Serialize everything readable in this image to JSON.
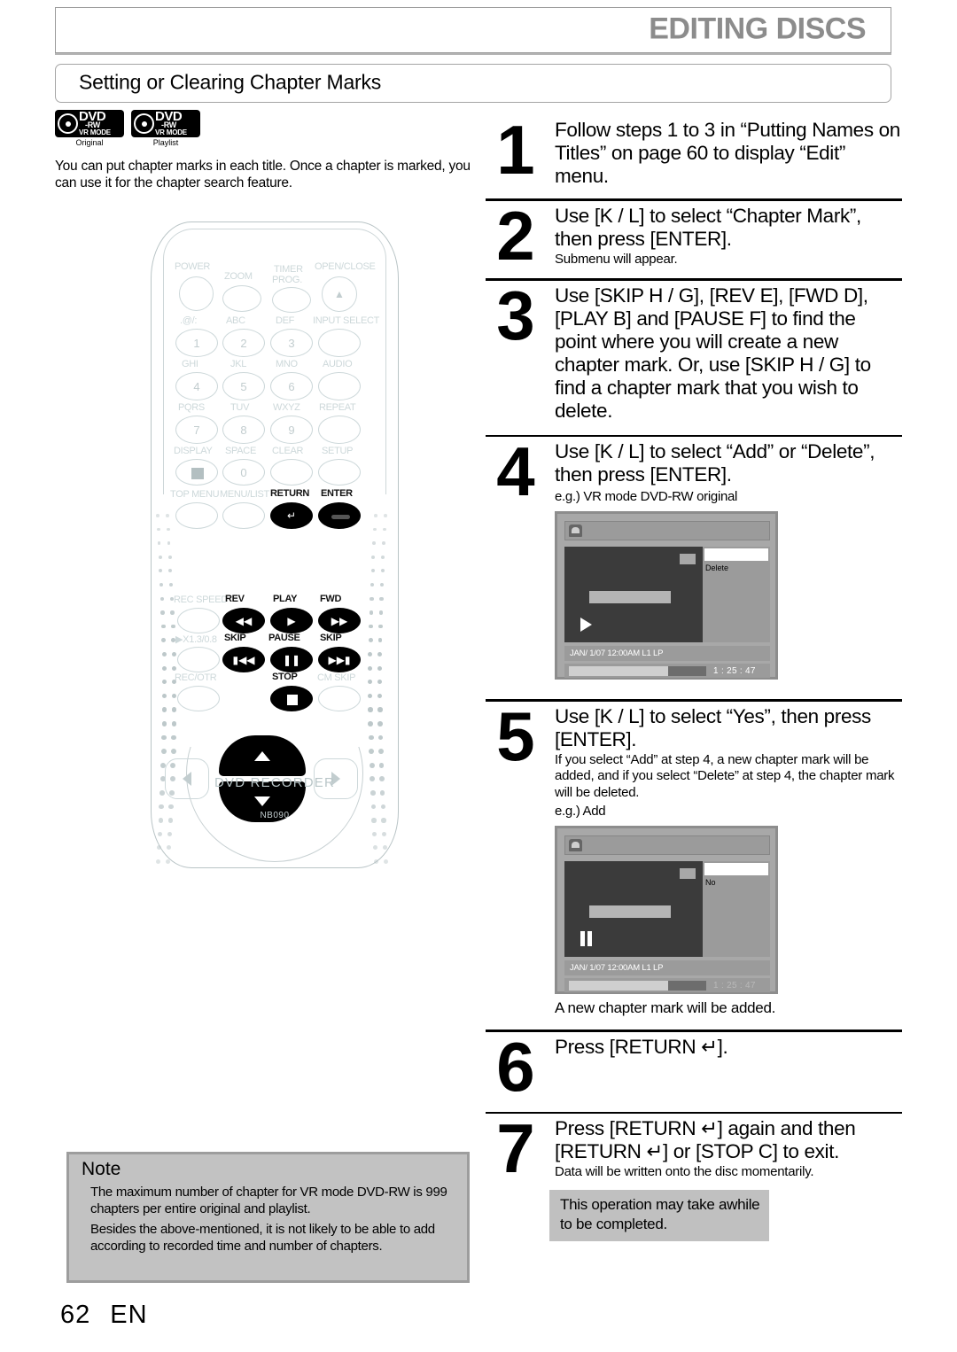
{
  "header": {
    "title": "EDITING DISCS",
    "section_title": "Setting or Clearing Chapter Marks"
  },
  "left": {
    "badges": [
      {
        "dvd": "DVD",
        "rw": "-RW",
        "mode": "VR MODE",
        "caption": "Original"
      },
      {
        "dvd": "DVD",
        "rw": "-RW",
        "mode": "VR MODE",
        "caption": "Playlist"
      }
    ],
    "intro": "You can put chapter marks in each title. Once a chapter is marked, you can use it for the chapter search feature."
  },
  "remote": {
    "brand": "DVD RECORDER",
    "model": "NB090",
    "labels": {
      "power": "POWER",
      "zoom": "ZOOM",
      "timer_prog_1": "TIMER",
      "timer_prog_2": "PROG.",
      "open_close": "OPEN/CLOSE",
      "key1_letters": ".@/:",
      "key2_letters": "ABC",
      "key3_letters": "DEF",
      "input_select": "INPUT SELECT",
      "key4_letters": "GHI",
      "key5_letters": "JKL",
      "key6_letters": "MNO",
      "audio": "AUDIO",
      "key7_letters": "PQRS",
      "key8_letters": "TUV",
      "key9_letters": "WXYZ",
      "repeat": "REPEAT",
      "display": "DISPLAY",
      "space": "SPACE",
      "clear": "CLEAR",
      "setup": "SETUP",
      "top_menu": "TOP MENU",
      "menu_list": "MENU/LIST",
      "return": "RETURN",
      "enter": "ENTER",
      "rec_speed": "REC SPEED",
      "rev": "REV",
      "play": "PLAY",
      "fwd": "FWD",
      "speed_x": "X1.3/0.8",
      "skip_back": "SKIP",
      "pause": "PAUSE",
      "skip_fwd": "SKIP",
      "rec_otr": "REC/OTR",
      "stop": "STOP",
      "cm_skip": "CM SKIP"
    },
    "numbers": {
      "n1": "1",
      "n2": "2",
      "n3": "3",
      "n4": "4",
      "n5": "5",
      "n6": "6",
      "n7": "7",
      "n8": "8",
      "n9": "9",
      "n0": "0"
    }
  },
  "steps": [
    {
      "number": "1",
      "main": "Follow steps 1 to 3 in “Putting Names on Titles” on page 60 to display “Edit” menu."
    },
    {
      "number": "2",
      "main": "Use [K / L] to select “Chapter Mark”, then press [ENTER].",
      "sub": "Submenu will appear."
    },
    {
      "number": "3",
      "main": "Use [SKIP H / G], [REV E], [FWD D], [PLAY B] and [PAUSE F] to find the point where you will create a new chapter mark. Or, use [SKIP H / G] to find a chapter mark that you wish to delete."
    },
    {
      "number": "4",
      "main": "Use [K / L] to select “Add” or “Delete”, then press [ENTER].",
      "eg": "e.g.) VR mode DVD-RW original"
    },
    {
      "number": "5",
      "main": "Use [K / L] to select “Yes”, then press [ENTER].",
      "sub": "If you select “Add” at step 4, a new chapter mark will be added, and if you select “Delete” at step 4, the chapter mark will be deleted.",
      "eg": "e.g.) Add",
      "after": "A new chapter mark will be added."
    },
    {
      "number": "6",
      "main": "Press [RETURN ↵]."
    },
    {
      "number": "7",
      "main": "Press [RETURN ↵] again and then [RETURN ↵] or [STOP C] to exit.",
      "sub": "Data will be written onto the disc momentarily.",
      "callout": "This operation may take awhile to be completed."
    }
  ],
  "screens": [
    {
      "side_option": "Delete",
      "info": "JAN/ 1/07 12:00AM L1   LP",
      "time": "1 : 25 : 47",
      "playback_state": "play"
    },
    {
      "side_option": "No",
      "info": "JAN/ 1/07 12:00AM L1   LP",
      "time": "1 : 25 : 47",
      "playback_state": "pause"
    }
  ],
  "note": {
    "title": "Note",
    "items": [
      "The maximum number of chapter for VR mode DVD-RW is 999 chapters per entire original and playlist.",
      "Besides the above-mentioned, it is not likely to be able to add according to recorded time and number of chapters."
    ]
  },
  "footer": {
    "page_number": "62",
    "language": "EN"
  }
}
